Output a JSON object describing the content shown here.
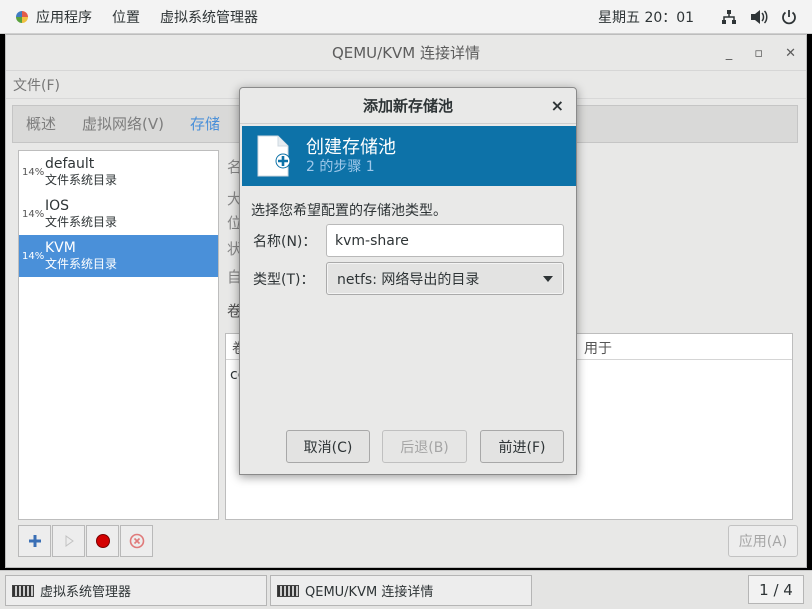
{
  "topbar": {
    "apps_label": "应用程序",
    "places_label": "位置",
    "app_menu_label": "虚拟系统管理器",
    "clock": "星期五 20：01",
    "icons": [
      "network-icon",
      "volume-icon",
      "power-icon"
    ]
  },
  "window": {
    "title": "QEMU/KVM 连接详情",
    "menu_file": "文件(F)",
    "controls": {
      "minimize": "_",
      "maximize": "▫",
      "close": "✕"
    }
  },
  "tabs": [
    {
      "label": "概述",
      "active": false
    },
    {
      "label": "虚拟网络(V)",
      "active": false
    },
    {
      "label": "存储",
      "active": true
    }
  ],
  "pools": [
    {
      "percent": "14%",
      "name": "default",
      "type": "文件系统目录",
      "selected": false
    },
    {
      "percent": "14%",
      "name": "IOS",
      "type": "文件系统目录",
      "selected": false
    },
    {
      "percent": "14%",
      "name": "KVM",
      "type": "文件系统目录",
      "selected": true
    }
  ],
  "details": {
    "labels_visible": [
      "名",
      "大",
      "位",
      "状",
      "自"
    ],
    "volumes_label": "卷",
    "vol_col_name": "卷",
    "vol_col_used": "用于",
    "vol_row_partial": "ce"
  },
  "bottom": {
    "apply_label": "应用(A)"
  },
  "dialog": {
    "title": "添加新存储池",
    "close": "×",
    "banner_title": "创建存储池",
    "banner_step": "2 的步骤 1",
    "description": "选择您希望配置的存储池类型。",
    "name_label": "名称(N)：",
    "name_value": "kvm-share",
    "type_label": "类型(T)：",
    "type_value": "netfs: 网络导出的目录",
    "cancel_label": "取消(C)",
    "back_label": "后退(B)",
    "forward_label": "前进(F)",
    "accent_color": "#0d72a8"
  },
  "taskbar": {
    "items": [
      "虚拟系统管理器",
      "QEMU/KVM 连接详情"
    ],
    "pager": "1 / 4"
  }
}
